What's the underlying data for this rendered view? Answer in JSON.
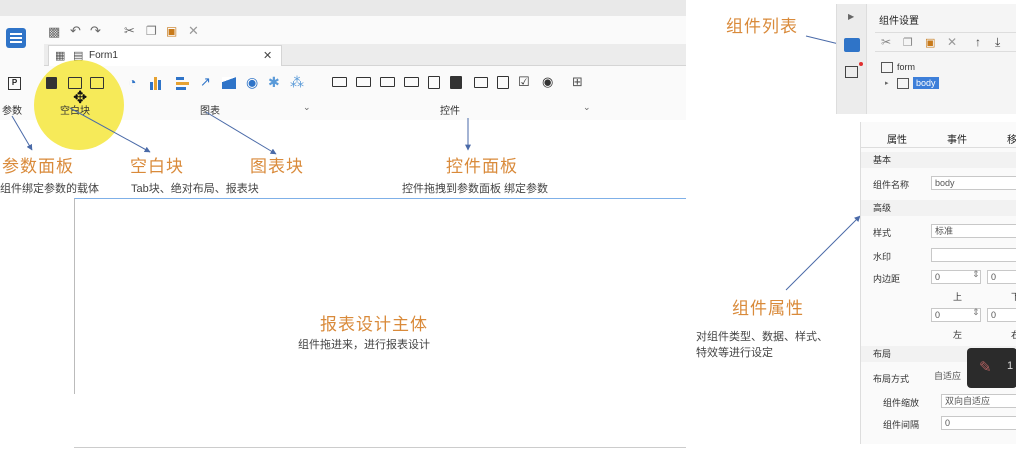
{
  "designer": {
    "tab_title": "Form1",
    "group_param": "参数",
    "group_blank": "空白块",
    "group_chart": "图表",
    "group_widgets": "控件"
  },
  "annotations": {
    "param_panel": {
      "title": "参数面板",
      "desc": "组件绑定参数的载体"
    },
    "blank_block": {
      "title": "空白块",
      "desc": "Tab块、绝对布局、报表块"
    },
    "chart_block": {
      "title": "图表块"
    },
    "widget_panel": {
      "title": "控件面板",
      "desc": "控件拖拽到参数面板 绑定参数"
    },
    "main_body": {
      "title": "报表设计主体",
      "desc": "组件拖进来，进行报表设计"
    },
    "component_list": {
      "title": "组件列表"
    },
    "component_props": {
      "title": "组件属性",
      "desc_line1": "对组件类型、数据、样式、",
      "desc_line2": "特效等进行设定"
    }
  },
  "component_settings": {
    "title": "组件设置",
    "tree_root": "form",
    "tree_child": "body"
  },
  "properties": {
    "tab_props": "属性",
    "tab_events": "事件",
    "tab_move": "移",
    "section_basic": "基本",
    "label_name": "组件名称",
    "value_name": "body",
    "section_advanced": "高级",
    "label_style": "样式",
    "value_style": "标准",
    "label_watermark": "水印",
    "label_padding": "内边距",
    "pad_top_val": "0",
    "pad_right_val": "0",
    "pad_top_lbl": "上",
    "pad_right_lbl": "下",
    "pad_left_val": "0",
    "pad_bottom_val": "0",
    "pad_left_lbl": "左",
    "pad_bottom_lbl": "右",
    "section_layout": "布局",
    "label_layout_mode": "布局方式",
    "value_layout_mode": "自适应",
    "label_scale": "组件缩放",
    "value_scale": "双向自适应",
    "label_gap": "组件间隔",
    "value_gap": "0"
  },
  "colors": {
    "annotation": "#d98a3a",
    "arrow": "#4a6aa8",
    "selection": "#3d7fd9",
    "highlight": "#f5e63c"
  },
  "chart_data": {
    "type": "table",
    "title": "",
    "rows": [
      {
        "label": "参数面板",
        "desc": "组件绑定参数的载体"
      },
      {
        "label": "空白块",
        "desc": "Tab块、绝对布局、报表块"
      },
      {
        "label": "图表块",
        "desc": ""
      },
      {
        "label": "控件面板",
        "desc": "控件拖拽到参数面板 绑定参数"
      },
      {
        "label": "报表设计主体",
        "desc": "组件拖进来，进行报表设计"
      },
      {
        "label": "组件列表",
        "desc": ""
      },
      {
        "label": "组件属性",
        "desc": "对组件类型、数据、样式、特效等进行设定"
      }
    ]
  }
}
